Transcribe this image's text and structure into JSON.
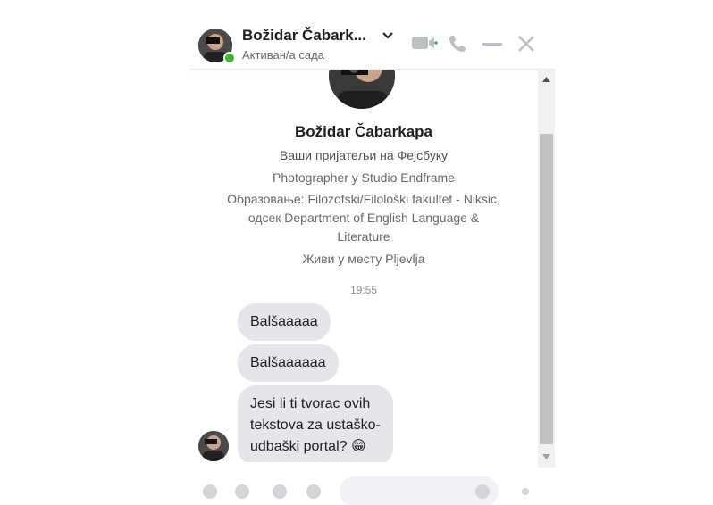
{
  "header": {
    "name": "Božidar Čabark...",
    "status": "Активан/а сада",
    "icons": [
      "chevron-down-icon",
      "video-call-icon",
      "phone-icon",
      "minimize-icon",
      "close-icon"
    ]
  },
  "profile": {
    "name": "Božidar Čabarkapa",
    "friends": "Ваши пријатељи на Фејсбуку",
    "work": "Photographer у Studio Endframe",
    "education": [
      "Образовање: Filozofski/Filološki fakultet - Niksic,",
      "одсек Department of English Language &",
      "Literature"
    ],
    "lives": "Живи у месту Pljevlja"
  },
  "conversation": {
    "timestamp": "19:55",
    "messages": [
      {
        "text": "Balšaaaaa"
      },
      {
        "text": "Balšaaaaaa"
      },
      {
        "lines": [
          "Jesi li ti tvorac ovih",
          "tekstova za ustaško-",
          "udbaški portal?"
        ],
        "emoji": "😁"
      }
    ]
  },
  "colors": {
    "accent": "#0084ff",
    "bubble": "#e4e6eb",
    "online": "#42b72a",
    "header_icon": "#bcc0c4"
  }
}
